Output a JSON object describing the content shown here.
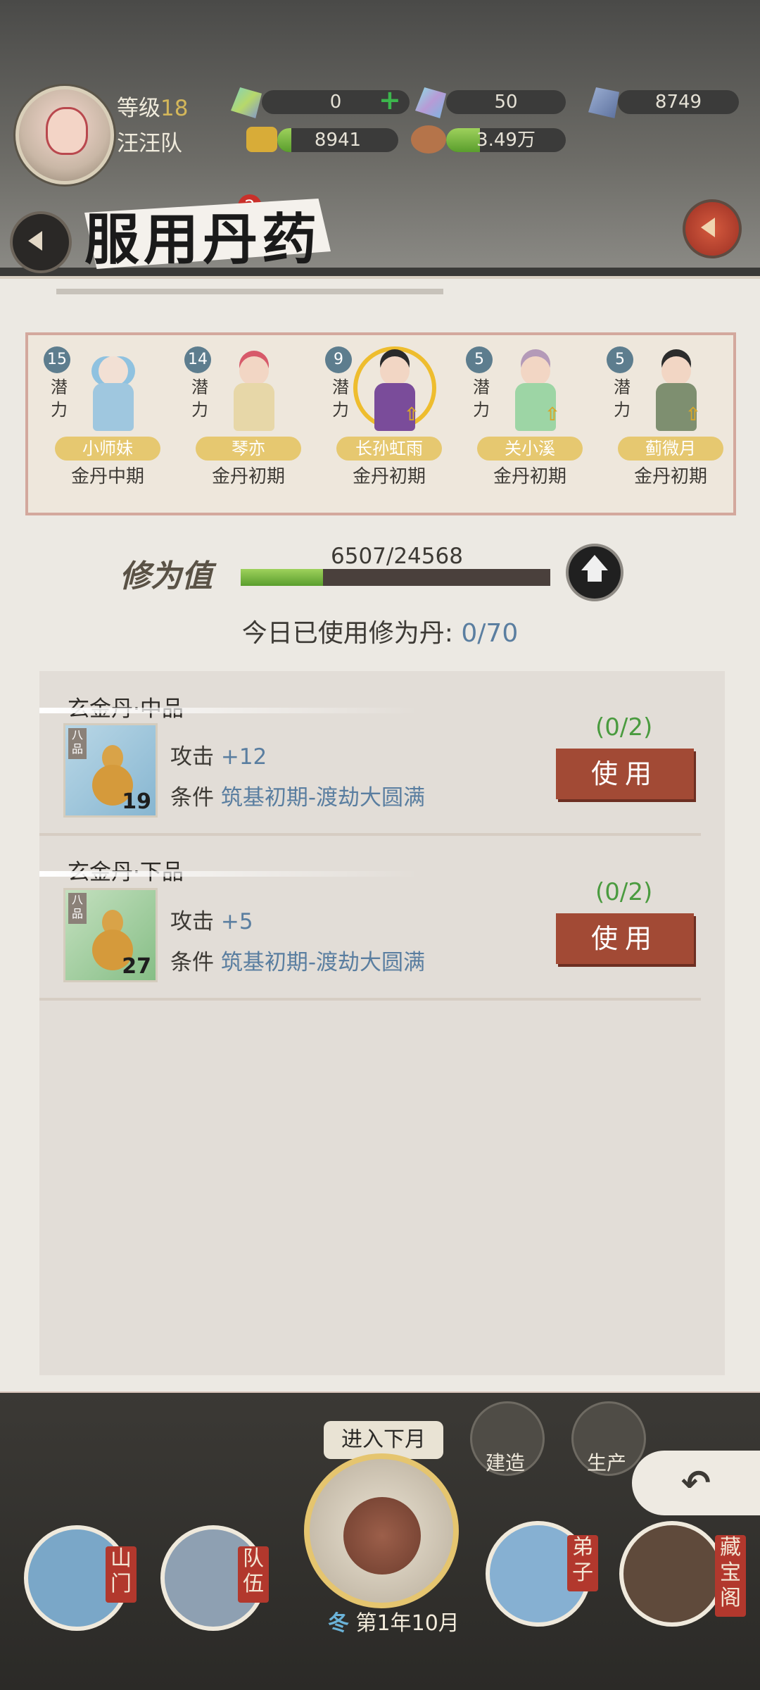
{
  "header": {
    "level_label": "等级",
    "level_value": "18",
    "team_name": "汪汪队",
    "resources": {
      "jade_a": "0",
      "jade_b": "50",
      "crystal": "8749",
      "gold": "8941",
      "food": "3.49万"
    },
    "tab_badge": "2"
  },
  "panel": {
    "title": "服用丹药",
    "characters": [
      {
        "potential": "15",
        "potential_label": "潜力",
        "name": "小师妹",
        "realm": "金丹中期"
      },
      {
        "potential": "14",
        "potential_label": "潜力",
        "name": "琴亦",
        "realm": "金丹初期"
      },
      {
        "potential": "9",
        "potential_label": "潜力",
        "name": "长孙虹雨",
        "realm": "金丹初期"
      },
      {
        "potential": "5",
        "potential_label": "潜力",
        "name": "关小溪",
        "realm": "金丹初期"
      },
      {
        "potential": "5",
        "potential_label": "潜力",
        "name": "蓟微月",
        "realm": "金丹初期"
      }
    ],
    "cultivation": {
      "label": "修为值",
      "value_text": "6507/24568",
      "progress_fraction": 0.265
    },
    "daily_usage": {
      "label": "今日已使用修为丹:",
      "value": "0/70"
    },
    "items": [
      {
        "name": "玄金丹·中品",
        "grade": "八品",
        "count": "19",
        "stat_label": "攻击",
        "stat_value": "+12",
        "cond_label": "条件",
        "cond_value": "筑基初期-渡劫大圆满",
        "quota": "(0/2)",
        "button": "使用"
      },
      {
        "name": "玄金丹·下品",
        "grade": "八品",
        "count": "27",
        "stat_label": "攻击",
        "stat_value": "+5",
        "cond_label": "条件",
        "cond_value": "筑基初期-渡劫大圆满",
        "quota": "(0/2)",
        "button": "使用"
      }
    ]
  },
  "bottom_nav": {
    "next_month": "进入下月",
    "build": "建造",
    "produce": "生产",
    "season": "冬",
    "date": "第1年10月",
    "gate": "山门",
    "team": "队伍",
    "disciple": "弟子",
    "treasury": "藏宝阁"
  }
}
